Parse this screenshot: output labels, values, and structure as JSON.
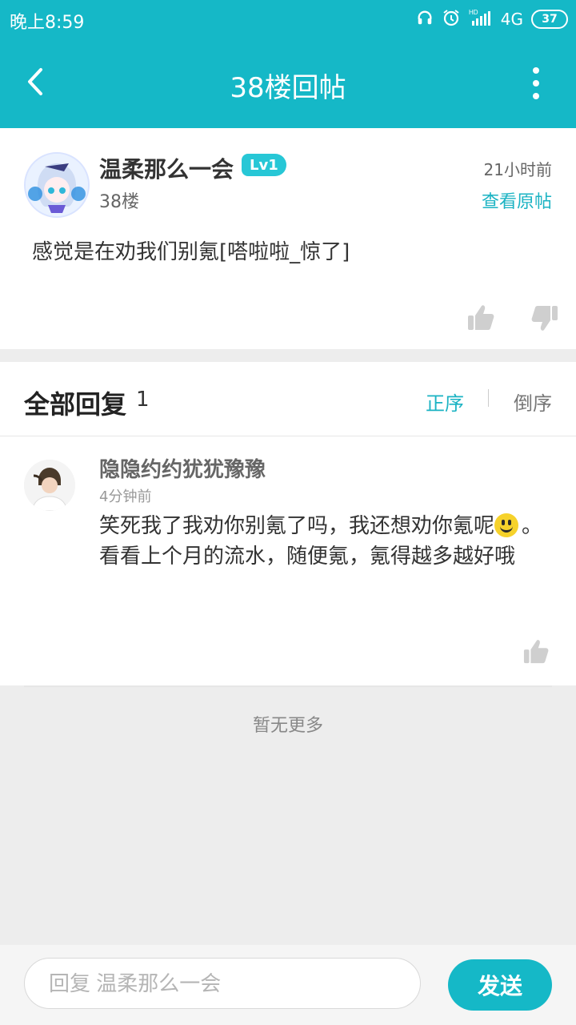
{
  "statusbar": {
    "time": "晚上8:59",
    "network": "4G",
    "battery": "37",
    "icons": [
      "headphones-icon",
      "alarm-icon",
      "hd-signal-icon",
      "battery-icon"
    ]
  },
  "header": {
    "title": "38楼回帖",
    "back_icon": "chevron-left-icon",
    "more_icon": "more-vertical-icon",
    "background": "#15b8c7"
  },
  "post": {
    "username": "温柔那么一会",
    "level": "Lv1",
    "floor": "38楼",
    "time_ago": "21小时前",
    "view_original": "查看原帖",
    "content": "感觉是在劝我们别氪[嗒啦啦_惊了]",
    "icons": [
      "thumbs-up-icon",
      "thumbs-down-icon"
    ]
  },
  "replies": {
    "title": "全部回复",
    "count": "1",
    "order_asc": "正序",
    "order_desc": "倒序",
    "items": [
      {
        "username": "隐隐约约犹犹豫豫",
        "time": "4分钟前",
        "text_before_emoji": "笑死我了我劝你别氪了吗，我还想劝你氪呢",
        "emoji": "smile-emoji",
        "text_after_emoji": "。看看上个月的流水，随便氪，氪得越多越好哦"
      }
    ]
  },
  "footer": {
    "no_more": "暂无更多",
    "reply_placeholder": "回复 温柔那么一会",
    "send_label": "发送"
  },
  "colors": {
    "accent": "#15b8c7",
    "link": "#1bb3c3"
  }
}
